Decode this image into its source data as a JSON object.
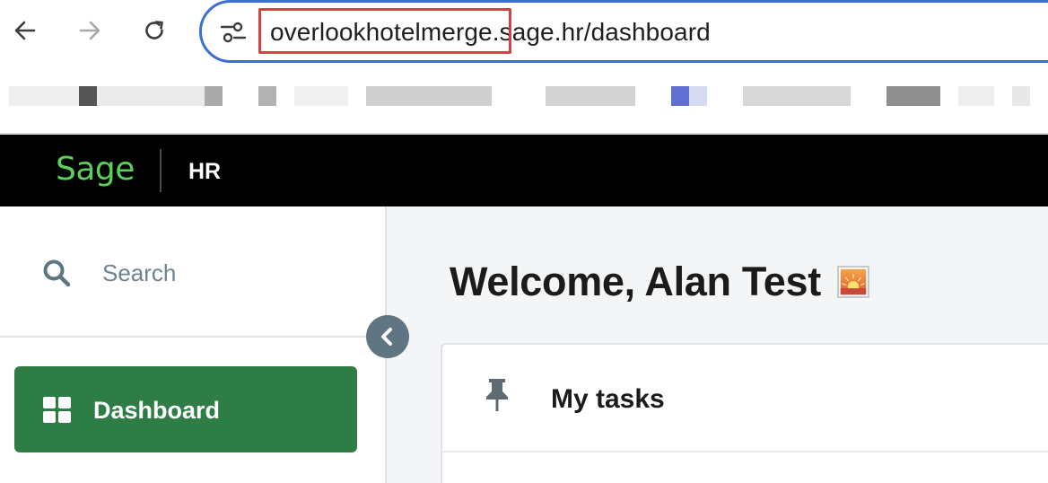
{
  "browser": {
    "url_highlighted": "overlookhotelmerge",
    "url_rest": ".sage.hr/dashboard",
    "colors": {
      "omnibox_border": "#3b6fd4",
      "highlight_box": "#d94040"
    },
    "icons": [
      "back-arrow-icon",
      "forward-arrow-icon",
      "reload-icon",
      "site-settings-icon"
    ]
  },
  "header": {
    "logo": "Sage",
    "product": "HR",
    "colors": {
      "background": "#000000",
      "logo": "#5bd15b"
    }
  },
  "sidebar": {
    "search_placeholder": "Search",
    "items": [
      {
        "label": "Dashboard",
        "icon": "dashboard-grid-icon",
        "active": true
      }
    ],
    "colors": {
      "active_item": "#2f7d46",
      "collapse_button": "#5f7582"
    }
  },
  "main": {
    "welcome": "Welcome, Alan Test",
    "cards": [
      {
        "title": "My tasks",
        "icon": "pin-icon"
      }
    ]
  }
}
